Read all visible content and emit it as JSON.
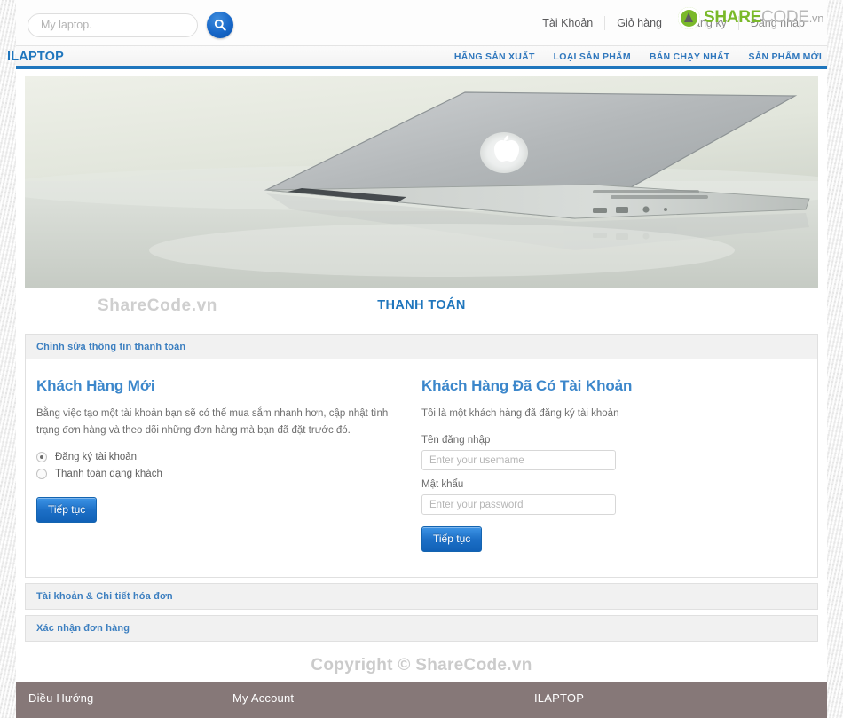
{
  "search": {
    "placeholder": "My laptop.",
    "value": "",
    "button_icon": "search-icon"
  },
  "topbar": {
    "links": [
      {
        "label": "Tài Khoản"
      },
      {
        "label": "Giỏ hàng"
      },
      {
        "label": "Đăng ký"
      },
      {
        "label": "Đăng nhập"
      }
    ]
  },
  "watermark": {
    "mark": "recycle-icon",
    "share": "SHARE",
    "code": "CODE",
    "vn": ".vn",
    "content_text": "ShareCode.vn",
    "brand_green": "#7ab929",
    "brand_gray": "#b9b9b9"
  },
  "nav": {
    "brand": "ILAPTOP",
    "items": [
      {
        "label": "HÃNG SẢN XUẤT"
      },
      {
        "label": "LOẠI SẢN PHẨM"
      },
      {
        "label": "BÁN CHẠY NHẤT"
      },
      {
        "label": "SẢN PHẨM MỚI"
      }
    ],
    "accent_color": "#1f76bd"
  },
  "hero": {
    "alt": "macbook-air-banner"
  },
  "page_title": "THANH TOÁN",
  "checkout": {
    "panels": [
      {
        "title": "Chỉnh sửa thông tin thanh toán",
        "open": true
      },
      {
        "title": "Tài khoản & Chi tiết hóa đơn",
        "open": false
      },
      {
        "title": "Xác nhận đơn hàng",
        "open": false
      }
    ],
    "new_customer": {
      "heading": "Khách Hàng Mới",
      "description": "Bằng việc tạo một tài khoản bạn sẽ có thế mua sắm nhanh hơn, cập nhật tình trạng đơn hàng và theo dõi những đơn hàng mà bạn đã đặt trước đó.",
      "options": [
        {
          "label": "Đăng ký tài khoản",
          "selected": true
        },
        {
          "label": "Thanh toán dạng khách",
          "selected": false
        }
      ],
      "submit_label": "Tiếp tục"
    },
    "returning_customer": {
      "heading": "Khách Hàng Đã Có Tài Khoản",
      "description": "Tôi là một khách hàng đã đăng ký tài khoản",
      "username_label": "Tên đăng nhập",
      "username_placeholder": "Enter your usemame",
      "username_value": "",
      "password_label": "Mật khẩu",
      "password_placeholder": "Enter your password",
      "password_value": "",
      "submit_label": "Tiếp tục"
    }
  },
  "copyright": "Copyright © ShareCode.vn",
  "footer": {
    "columns": [
      {
        "heading": "Điều Hướng"
      },
      {
        "heading": "My Account"
      },
      {
        "heading": "ILAPTOP"
      }
    ],
    "background": "#867878"
  }
}
